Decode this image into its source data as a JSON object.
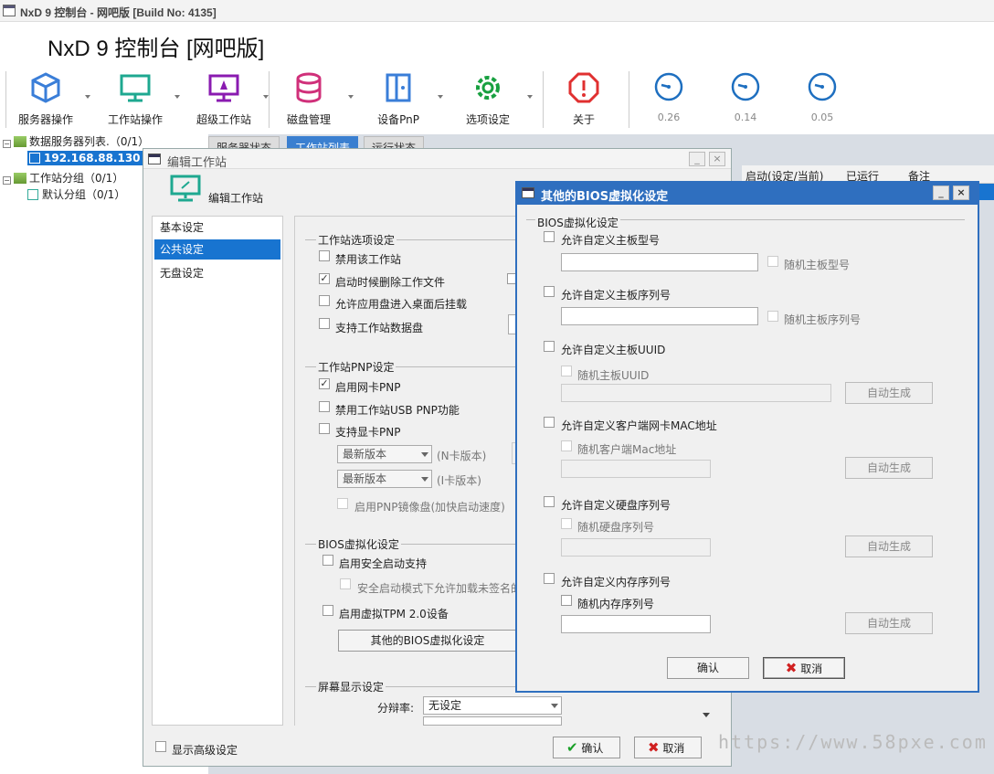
{
  "app": {
    "window_title": "NxD 9 控制台 - 网吧版 [Build No: 4135]",
    "header_title": "NxD 9 控制台 [网吧版]"
  },
  "toolbar": {
    "server_ops": "服务器操作",
    "workstation_ops": "工作站操作",
    "super_ws": "超级工作站",
    "disk_mgmt": "磁盘管理",
    "device_pnp": "设备PnP",
    "options": "选项设定",
    "about": "关于",
    "gauges": [
      "0.26",
      "0.14",
      "0.05"
    ]
  },
  "tree": {
    "data_servers": "数据服务器列表.（0/1）",
    "server_ip": "192.168.88.130",
    "ws_groups": "工作站分组（0/1）",
    "default_group": "默认分组（0/1）"
  },
  "main_tabs": [
    "服务器状态",
    "工作站列表",
    "运行状态"
  ],
  "grid_columns": [
    "启动(设定/当前)",
    "已运行",
    "备注"
  ],
  "edit_dialog": {
    "title": "编辑工作站",
    "header": "编辑工作站",
    "nav": [
      "基本设定",
      "公共设定",
      "无盘设定"
    ],
    "ws_options_group": "工作站选项设定",
    "ws_options": [
      "禁用该工作站",
      "启动时候删除工作文件",
      "允许应用盘进入桌面后挂载",
      "支持工作站数据盘"
    ],
    "pnp_group": "工作站PNP设定",
    "pnp_options": [
      "启用网卡PNP",
      "禁用工作站USB PNP功能",
      "支持显卡PNP"
    ],
    "n_version": "最新版本",
    "n_label": "(N卡版本)",
    "i_version": "最新版本",
    "i_label": "(I卡版本)",
    "pnp_mirror": "启用PNP镜像盘(加快启动速度)",
    "bios_group": "BIOS虚拟化设定",
    "secure_boot": "启用安全启动支持",
    "secure_sub": "安全启动模式下允许加载未签名的",
    "tpm": "启用虚拟TPM 2.0设备",
    "other_bios_btn": "其他的BIOS虚拟化设定",
    "display_group": "屏幕显示设定",
    "resolution_label": "分辩率:",
    "resolution_value": "无设定",
    "show_advanced": "显示高级设定",
    "ok": "确认",
    "cancel": "取消"
  },
  "bios_dialog": {
    "title": "其他的BIOS虚拟化设定",
    "group": "BIOS虚拟化设定",
    "board_model": "允许自定义主板型号",
    "rand_board_model": "随机主板型号",
    "board_serial": "允许自定义主板序列号",
    "rand_board_serial": "随机主板序列号",
    "board_uuid": "允许自定义主板UUID",
    "rand_board_uuid": "随机主板UUID",
    "client_mac": "允许自定义客户端网卡MAC地址",
    "rand_client_mac": "随机客户端Mac地址",
    "disk_serial": "允许自定义硬盘序列号",
    "rand_disk_serial": "随机硬盘序列号",
    "mem_serial": "允许自定义内存序列号",
    "rand_mem_serial": "随机内存序列号",
    "auto_gen": "自动生成",
    "ok": "确认",
    "cancel": "取消"
  },
  "watermark": "https://www.58pxe.com"
}
